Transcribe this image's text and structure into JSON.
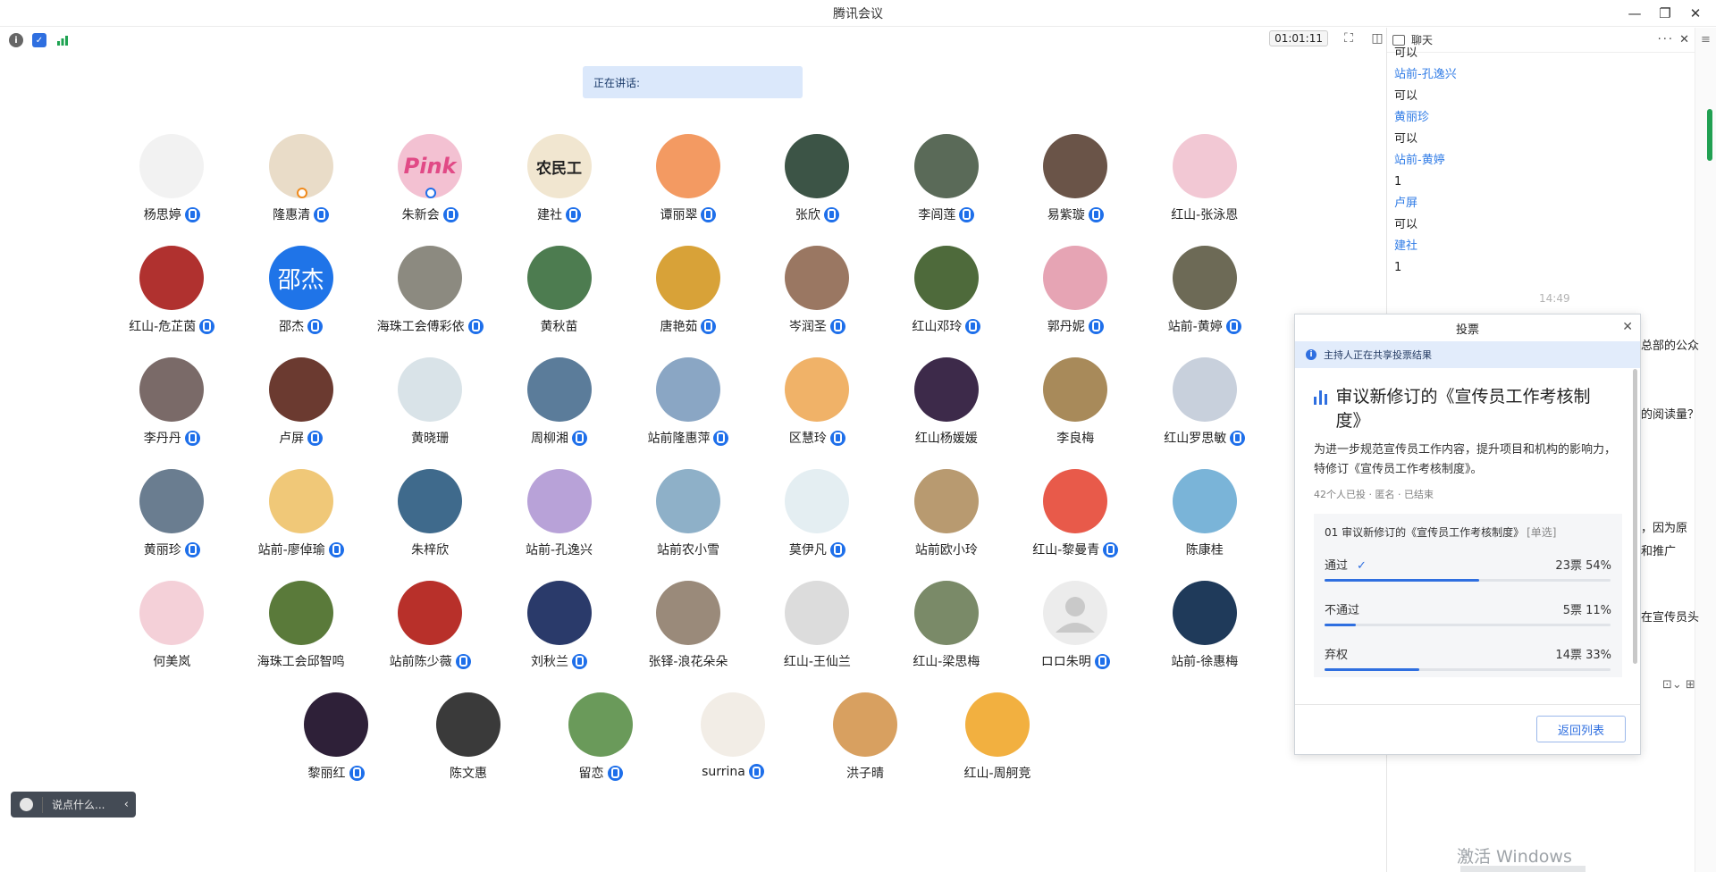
{
  "window": {
    "title": "腾讯会议"
  },
  "toolbar": {
    "timer": "01:01:11"
  },
  "speaking": {
    "label": "正在讲话:"
  },
  "participant_rows": [
    [
      {
        "name": "杨思婷",
        "mic": true,
        "bg": "#f2f2f2"
      },
      {
        "name": "隆惠清",
        "mic": true,
        "bg": "#e9dcc8",
        "badge": "orange"
      },
      {
        "name": "朱新会",
        "mic": true,
        "bg": "#f3c1d2",
        "text": "Pink",
        "badge": "blue"
      },
      {
        "name": "建社",
        "mic": true,
        "bg": "#f1e6d0",
        "text": "农民工"
      },
      {
        "name": "谭丽翠",
        "mic": true,
        "bg": "#f39a62"
      },
      {
        "name": "张欣",
        "mic": true,
        "bg": "#3c5446"
      },
      {
        "name": "李闾莲",
        "mic": true,
        "bg": "#5a6a58"
      },
      {
        "name": "易紫璇",
        "mic": true,
        "bg": "#6a5448"
      },
      {
        "name": "红山-张泳恩",
        "mic": false,
        "bg": "#f2c8d4"
      }
    ],
    [
      {
        "name": "红山-危芷茵",
        "mic": true,
        "bg": "#b0312f"
      },
      {
        "name": "邵杰",
        "mic": true,
        "bg": "#1f74e8",
        "text": "邵杰"
      },
      {
        "name": "海珠工会傅彩依",
        "mic": true,
        "bg": "#8c8a80"
      },
      {
        "name": "黄秋苗",
        "mic": false,
        "bg": "#4d7c50"
      },
      {
        "name": "唐艳茹",
        "mic": true,
        "bg": "#d8a238"
      },
      {
        "name": "岑润圣",
        "mic": true,
        "bg": "#9a7762"
      },
      {
        "name": "红山邓玲",
        "mic": true,
        "bg": "#4e6a3b"
      },
      {
        "name": "郭丹妮",
        "mic": true,
        "bg": "#e6a4b4"
      },
      {
        "name": "站前-黄婷",
        "mic": true,
        "bg": "#6d6a56"
      }
    ],
    [
      {
        "name": "李丹丹",
        "mic": true,
        "bg": "#7a6a68"
      },
      {
        "name": "卢屏",
        "mic": true,
        "bg": "#6b3a30"
      },
      {
        "name": "黄晓珊",
        "mic": false,
        "bg": "#d9e3e8"
      },
      {
        "name": "周柳湘",
        "mic": true,
        "bg": "#5b7c9a"
      },
      {
        "name": "站前隆惠萍",
        "mic": true,
        "bg": "#8aa6c4"
      },
      {
        "name": "区慧玲",
        "mic": true,
        "bg": "#f0b268"
      },
      {
        "name": "红山杨媛媛",
        "mic": false,
        "bg": "#3d2a4a"
      },
      {
        "name": "李良梅",
        "mic": false,
        "bg": "#a88a5a"
      },
      {
        "name": "红山罗思敏",
        "mic": true,
        "bg": "#c8d0dc"
      }
    ],
    [
      {
        "name": "黄丽珍",
        "mic": true,
        "bg": "#6a7d90"
      },
      {
        "name": "站前-廖倬瑜",
        "mic": true,
        "bg": "#f0c878"
      },
      {
        "name": "朱梓欣",
        "mic": false,
        "bg": "#3f6a8c"
      },
      {
        "name": "站前-孔逸兴",
        "mic": false,
        "bg": "#b8a2d8"
      },
      {
        "name": "站前农小雪",
        "mic": false,
        "bg": "#8eb0c8"
      },
      {
        "name": "莫伊凡",
        "mic": true,
        "bg": "#e4eef2"
      },
      {
        "name": "站前欧小玲",
        "mic": false,
        "bg": "#b89a70"
      },
      {
        "name": "红山-黎曼青",
        "mic": true,
        "bg": "#e85a4a"
      },
      {
        "name": "陈康桂",
        "mic": false,
        "bg": "#7ab4d8"
      }
    ],
    [
      {
        "name": "何美岚",
        "mic": false,
        "bg": "#f4d0d8"
      },
      {
        "name": "海珠工会邱智鸣",
        "mic": false,
        "bg": "#5a7a3a"
      },
      {
        "name": "站前陈少薇",
        "mic": true,
        "bg": "#b8302a"
      },
      {
        "name": "刘秋兰",
        "mic": true,
        "bg": "#2a3a6a"
      },
      {
        "name": "张铎-浪花朵朵",
        "mic": false,
        "bg": "#9a8a7a"
      },
      {
        "name": "红山-王仙兰",
        "mic": false,
        "bg": "#dcdcdc"
      },
      {
        "name": "红山-梁思梅",
        "mic": false,
        "bg": "#7a8a68"
      },
      {
        "name": "ロロ朱明",
        "mic": true,
        "bg": "#ececec",
        "default": true
      },
      {
        "name": "站前-徐惠梅",
        "mic": false,
        "bg": "#1f3a5a"
      }
    ],
    [
      {
        "name": "黎丽红",
        "mic": true,
        "bg": "#2e2038"
      },
      {
        "name": "陈文惠",
        "mic": false,
        "bg": "#3a3a3a"
      },
      {
        "name": "留恋",
        "mic": true,
        "bg": "#6a9a5a"
      },
      {
        "name": "surrina",
        "mic": true,
        "bg": "#f2ede6"
      },
      {
        "name": "洪子晴",
        "mic": false,
        "bg": "#d8a060"
      },
      {
        "name": "红山-周舸竞",
        "mic": false,
        "bg": "#f2b040"
      }
    ]
  ],
  "chat": {
    "title": "聊天",
    "messages": [
      {
        "sender": "站前-孔逸兴",
        "text": "可以"
      },
      {
        "sender": "黄丽珍",
        "text": "可以"
      },
      {
        "sender": "站前-黄婷",
        "text": "1"
      },
      {
        "sender": "卢屏",
        "text": "可以"
      },
      {
        "sender": "建社",
        "text": "1"
      }
    ],
    "top_text": "可以",
    "time": "14:49",
    "peek_texts": [
      "总部的公众",
      "的阅读量？",
      "，因为原",
      "和推广",
      "在宣传员头"
    ],
    "watermark": "激活 Windows"
  },
  "chat_input": {
    "placeholder": "说点什么..."
  },
  "vote": {
    "header": "投票",
    "notice": "主持人正在共享投票结果",
    "title": "审议新修订的《宣传员工作考核制度》",
    "description": "为进一步规范宣传员工作内容，提升项目和机构的影响力，特修订《宣传员工作考核制度》。",
    "meta": "42个人已投 · 匿名 · 已结束",
    "question": "01 审议新修订的《宣传员工作考核制度》",
    "question_tag": "[单选]",
    "options": [
      {
        "label": "通过",
        "votes": "23票 54%",
        "fraction": 0.54,
        "selected": true
      },
      {
        "label": "不通过",
        "votes": "5票 11%",
        "fraction": 0.11,
        "selected": false
      },
      {
        "label": "弃权",
        "votes": "14票 33%",
        "fraction": 0.33,
        "selected": false
      }
    ],
    "back_button": "返回列表"
  },
  "colors": {
    "accent": "#2f6fe0",
    "mic": "#1e6fea",
    "chat_sender": "#2f7be6"
  }
}
